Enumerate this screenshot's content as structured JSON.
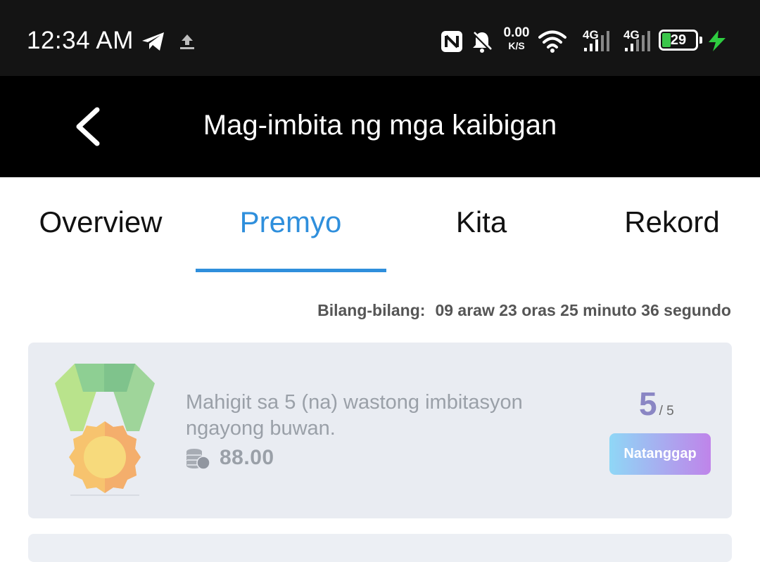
{
  "status_bar": {
    "time": "12:34 AM",
    "icons": [
      "telegram-icon",
      "upload-icon",
      "nfc-icon",
      "bell-off-icon",
      "wifi-icon",
      "signal-icon",
      "signal-icon",
      "charging-icon"
    ],
    "net_speed_value": "0.00",
    "net_speed_unit": "K/S",
    "sim1_label": "4G",
    "sim2_label": "4G",
    "battery_level": "29"
  },
  "app_bar": {
    "title": "Mag-imbita ng mga kaibigan",
    "back_icon": "chevron-left-icon"
  },
  "tabs": [
    {
      "label": "Overview",
      "active": false
    },
    {
      "label": "Premyo",
      "active": true
    },
    {
      "label": "Kita",
      "active": false
    },
    {
      "label": "Rekord",
      "active": false
    }
  ],
  "accent_color": "#2f8fdc",
  "countdown": {
    "label": "Bilang-bilang:",
    "value": "09 araw 23 oras 25 minuto 36 segundo"
  },
  "rewards": [
    {
      "icon": "medal-icon",
      "description": "Mahigit sa 5 (na) wastong imbitasyon ngayong buwan.",
      "coin_icon": "coins-icon",
      "amount": "88.00",
      "progress_current": "5",
      "progress_total": "/ 5",
      "button_label": "Natanggap"
    }
  ]
}
